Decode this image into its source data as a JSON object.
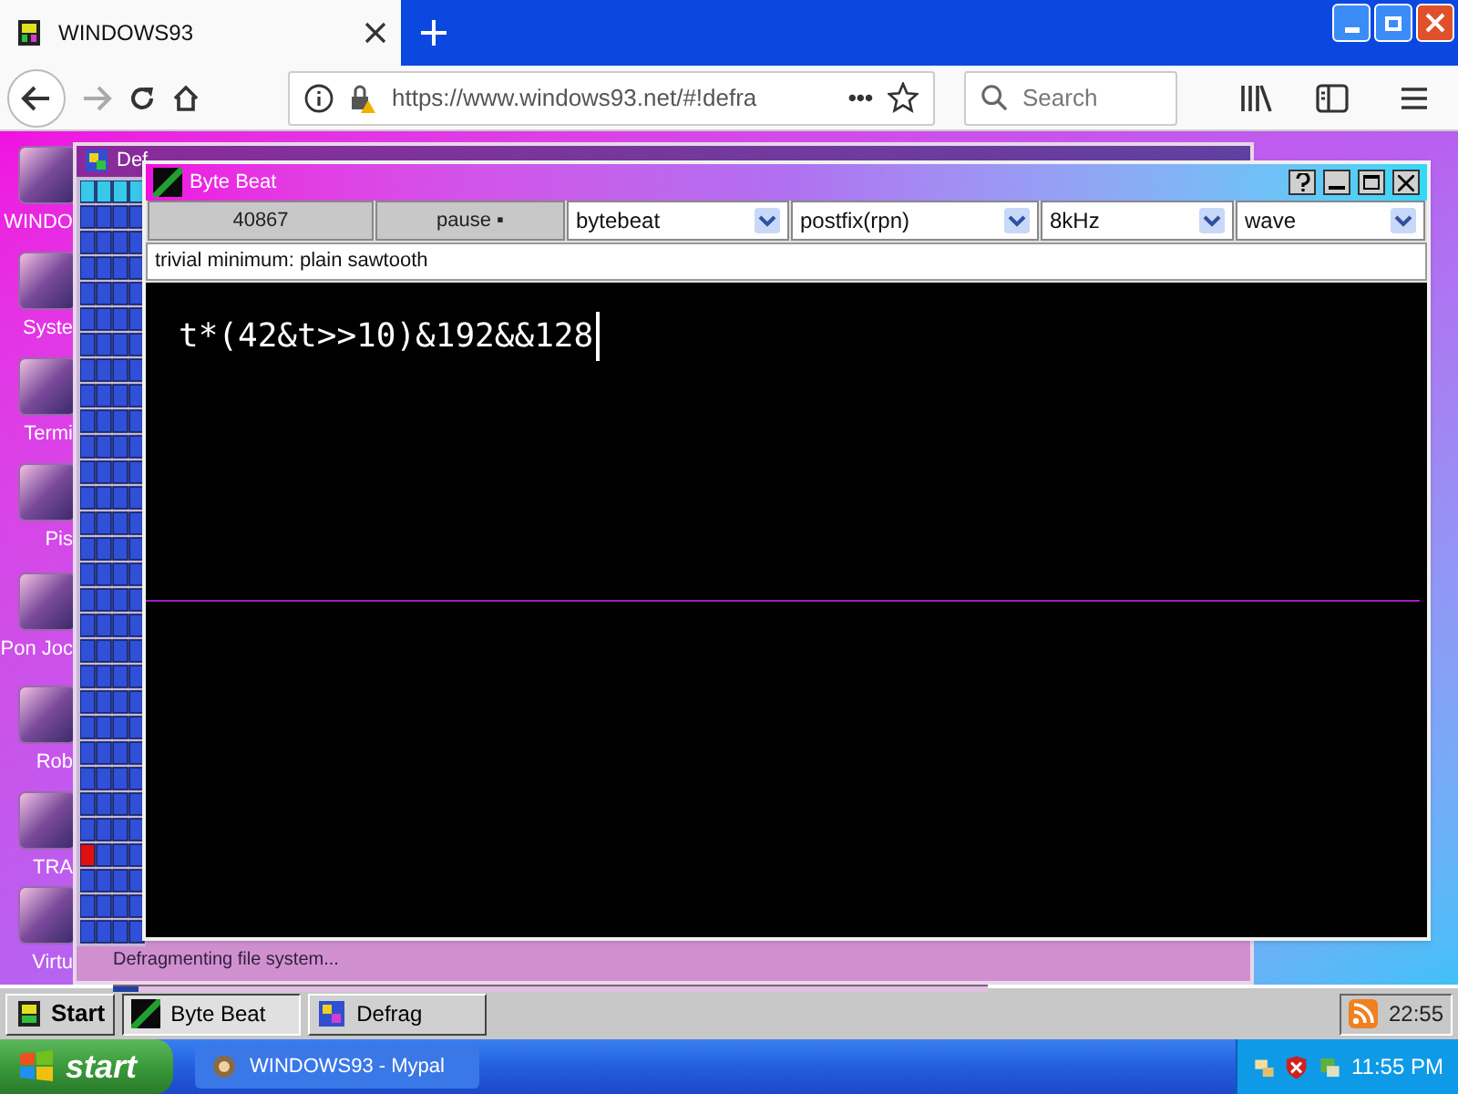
{
  "browser": {
    "tab": {
      "title": "WINDOWS93"
    },
    "url": "https://www.windows93.net/#!defra",
    "search": {
      "placeholder": "Search"
    },
    "more": "•••",
    "forward_disabled": true
  },
  "desktop": {
    "icons": [
      {
        "label": "WINDO"
      },
      {
        "label": "Syste"
      },
      {
        "label": "Termi"
      },
      {
        "label": "Pis"
      },
      {
        "label": "Pon Joc"
      },
      {
        "label": "Rob"
      },
      {
        "label": "TRA"
      },
      {
        "label": "Virtu"
      }
    ],
    "defrag": {
      "title": "Def",
      "status": "Defragmenting file system...",
      "level": 0.03
    },
    "bytebeat": {
      "title": "Byte Beat",
      "counter": "40867",
      "pause": "pause ▪",
      "selects": [
        "bytebeat",
        "postfix(rpn)",
        "8kHz",
        "wave"
      ],
      "description": "trivial minimum: plain sawtooth",
      "code": "t*(42&t>>10)&192&&128"
    }
  },
  "taskbar93": {
    "start": "Start",
    "tasks": [
      {
        "label": "Byte Beat",
        "selected": true
      },
      {
        "label": "Defrag",
        "selected": false
      }
    ],
    "clock": "22:55"
  },
  "xp_taskbar": {
    "start": "start",
    "tasks": [
      {
        "label": "WINDOWS93 - Mypal",
        "selected": false
      }
    ],
    "clock": "11:55 PM"
  }
}
